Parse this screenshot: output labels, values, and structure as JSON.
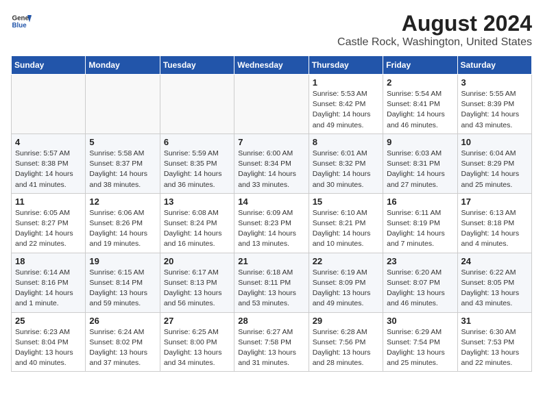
{
  "header": {
    "logo_line1": "General",
    "logo_line2": "Blue",
    "title": "August 2024",
    "subtitle": "Castle Rock, Washington, United States"
  },
  "days_of_week": [
    "Sunday",
    "Monday",
    "Tuesday",
    "Wednesday",
    "Thursday",
    "Friday",
    "Saturday"
  ],
  "weeks": [
    [
      {
        "day": "",
        "info": ""
      },
      {
        "day": "",
        "info": ""
      },
      {
        "day": "",
        "info": ""
      },
      {
        "day": "",
        "info": ""
      },
      {
        "day": "1",
        "info": "Sunrise: 5:53 AM\nSunset: 8:42 PM\nDaylight: 14 hours\nand 49 minutes."
      },
      {
        "day": "2",
        "info": "Sunrise: 5:54 AM\nSunset: 8:41 PM\nDaylight: 14 hours\nand 46 minutes."
      },
      {
        "day": "3",
        "info": "Sunrise: 5:55 AM\nSunset: 8:39 PM\nDaylight: 14 hours\nand 43 minutes."
      }
    ],
    [
      {
        "day": "4",
        "info": "Sunrise: 5:57 AM\nSunset: 8:38 PM\nDaylight: 14 hours\nand 41 minutes."
      },
      {
        "day": "5",
        "info": "Sunrise: 5:58 AM\nSunset: 8:37 PM\nDaylight: 14 hours\nand 38 minutes."
      },
      {
        "day": "6",
        "info": "Sunrise: 5:59 AM\nSunset: 8:35 PM\nDaylight: 14 hours\nand 36 minutes."
      },
      {
        "day": "7",
        "info": "Sunrise: 6:00 AM\nSunset: 8:34 PM\nDaylight: 14 hours\nand 33 minutes."
      },
      {
        "day": "8",
        "info": "Sunrise: 6:01 AM\nSunset: 8:32 PM\nDaylight: 14 hours\nand 30 minutes."
      },
      {
        "day": "9",
        "info": "Sunrise: 6:03 AM\nSunset: 8:31 PM\nDaylight: 14 hours\nand 27 minutes."
      },
      {
        "day": "10",
        "info": "Sunrise: 6:04 AM\nSunset: 8:29 PM\nDaylight: 14 hours\nand 25 minutes."
      }
    ],
    [
      {
        "day": "11",
        "info": "Sunrise: 6:05 AM\nSunset: 8:27 PM\nDaylight: 14 hours\nand 22 minutes."
      },
      {
        "day": "12",
        "info": "Sunrise: 6:06 AM\nSunset: 8:26 PM\nDaylight: 14 hours\nand 19 minutes."
      },
      {
        "day": "13",
        "info": "Sunrise: 6:08 AM\nSunset: 8:24 PM\nDaylight: 14 hours\nand 16 minutes."
      },
      {
        "day": "14",
        "info": "Sunrise: 6:09 AM\nSunset: 8:23 PM\nDaylight: 14 hours\nand 13 minutes."
      },
      {
        "day": "15",
        "info": "Sunrise: 6:10 AM\nSunset: 8:21 PM\nDaylight: 14 hours\nand 10 minutes."
      },
      {
        "day": "16",
        "info": "Sunrise: 6:11 AM\nSunset: 8:19 PM\nDaylight: 14 hours\nand 7 minutes."
      },
      {
        "day": "17",
        "info": "Sunrise: 6:13 AM\nSunset: 8:18 PM\nDaylight: 14 hours\nand 4 minutes."
      }
    ],
    [
      {
        "day": "18",
        "info": "Sunrise: 6:14 AM\nSunset: 8:16 PM\nDaylight: 14 hours\nand 1 minute."
      },
      {
        "day": "19",
        "info": "Sunrise: 6:15 AM\nSunset: 8:14 PM\nDaylight: 13 hours\nand 59 minutes."
      },
      {
        "day": "20",
        "info": "Sunrise: 6:17 AM\nSunset: 8:13 PM\nDaylight: 13 hours\nand 56 minutes."
      },
      {
        "day": "21",
        "info": "Sunrise: 6:18 AM\nSunset: 8:11 PM\nDaylight: 13 hours\nand 53 minutes."
      },
      {
        "day": "22",
        "info": "Sunrise: 6:19 AM\nSunset: 8:09 PM\nDaylight: 13 hours\nand 49 minutes."
      },
      {
        "day": "23",
        "info": "Sunrise: 6:20 AM\nSunset: 8:07 PM\nDaylight: 13 hours\nand 46 minutes."
      },
      {
        "day": "24",
        "info": "Sunrise: 6:22 AM\nSunset: 8:05 PM\nDaylight: 13 hours\nand 43 minutes."
      }
    ],
    [
      {
        "day": "25",
        "info": "Sunrise: 6:23 AM\nSunset: 8:04 PM\nDaylight: 13 hours\nand 40 minutes."
      },
      {
        "day": "26",
        "info": "Sunrise: 6:24 AM\nSunset: 8:02 PM\nDaylight: 13 hours\nand 37 minutes."
      },
      {
        "day": "27",
        "info": "Sunrise: 6:25 AM\nSunset: 8:00 PM\nDaylight: 13 hours\nand 34 minutes."
      },
      {
        "day": "28",
        "info": "Sunrise: 6:27 AM\nSunset: 7:58 PM\nDaylight: 13 hours\nand 31 minutes."
      },
      {
        "day": "29",
        "info": "Sunrise: 6:28 AM\nSunset: 7:56 PM\nDaylight: 13 hours\nand 28 minutes."
      },
      {
        "day": "30",
        "info": "Sunrise: 6:29 AM\nSunset: 7:54 PM\nDaylight: 13 hours\nand 25 minutes."
      },
      {
        "day": "31",
        "info": "Sunrise: 6:30 AM\nSunset: 7:53 PM\nDaylight: 13 hours\nand 22 minutes."
      }
    ]
  ]
}
